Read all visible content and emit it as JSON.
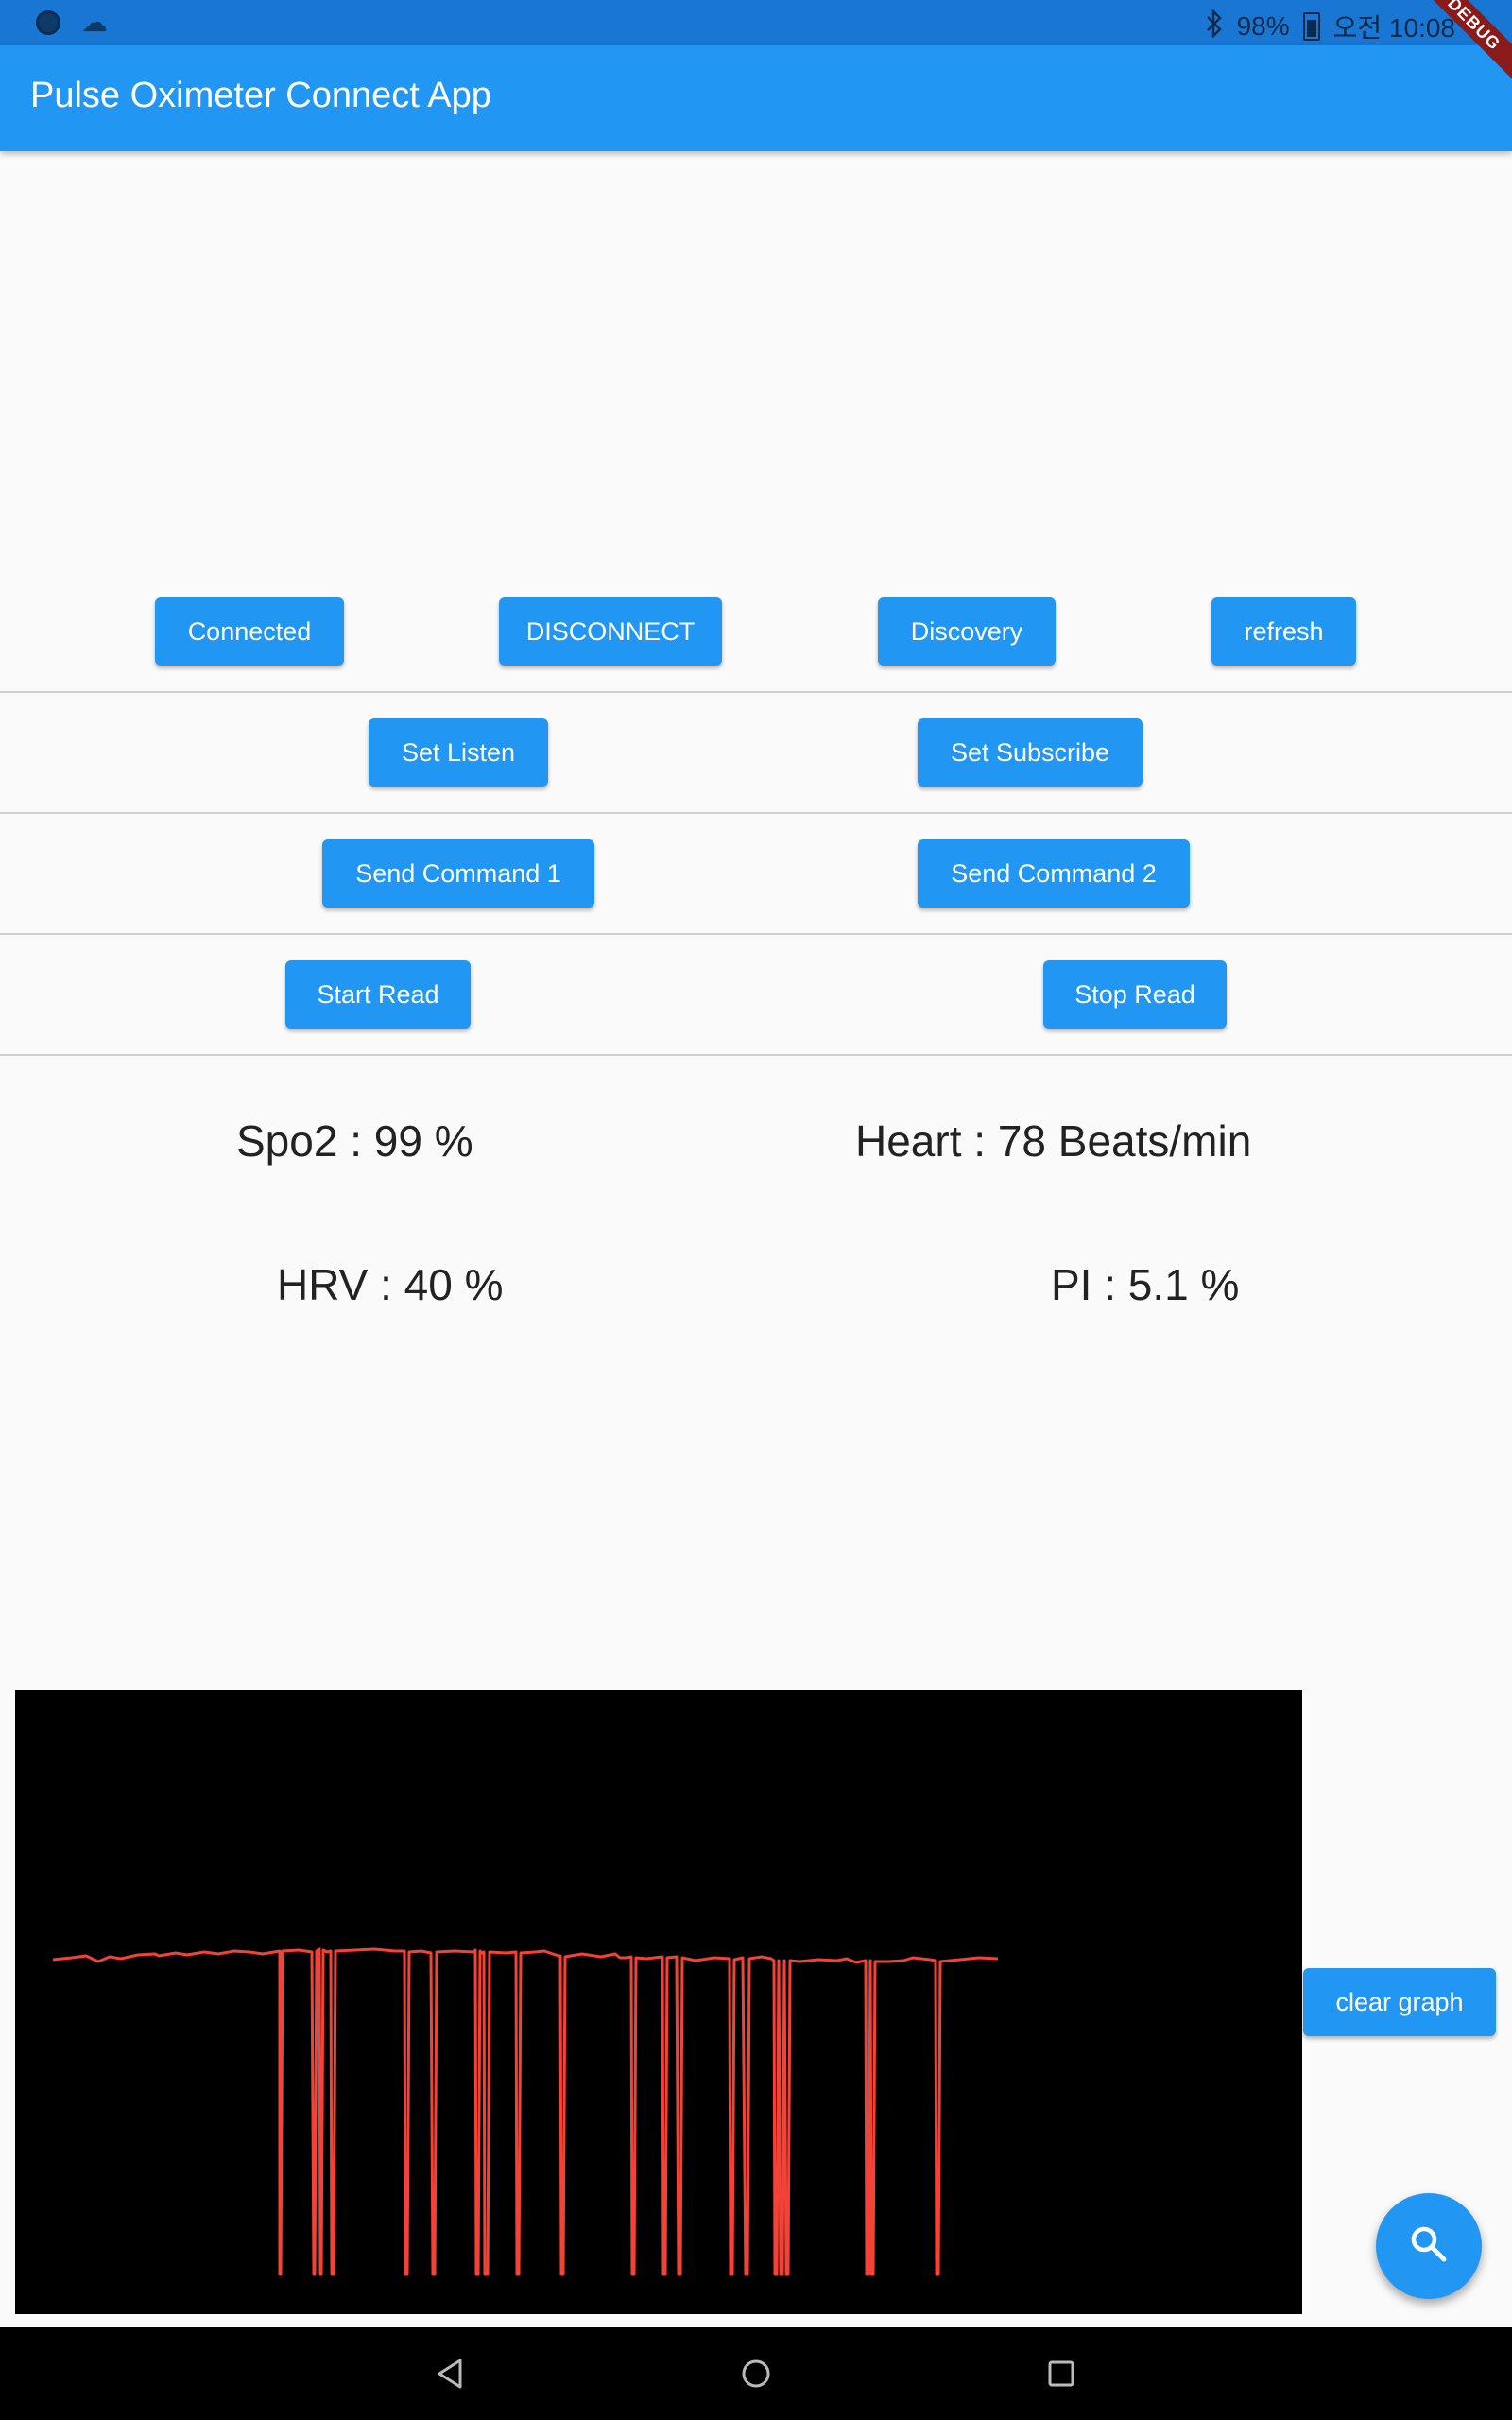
{
  "status_bar": {
    "battery": "98%",
    "time": "오전 10:08"
  },
  "debug_banner": "DEBUG",
  "app_bar": {
    "title": "Pulse Oximeter Connect App"
  },
  "controls": {
    "connected_label": "Connected",
    "disconnect_label": "DISCONNECT",
    "discovery_label": "Discovery",
    "refresh_label": "refresh",
    "set_listen_label": "Set Listen",
    "set_subscribe_label": "Set Subscribe",
    "send_command_1_label": "Send Command 1",
    "send_command_2_label": "Send Command 2",
    "start_read_label": "Start Read",
    "stop_read_label": "Stop Read"
  },
  "readings": {
    "spo2": "Spo2 : 99 %",
    "heart": "Heart : 78 Beats/min",
    "hrv": "HRV : 40 %",
    "pi": "PI : 5.1 %"
  },
  "graph": {
    "line_color": "#f44336",
    "background": "#000000"
  },
  "clear_graph_label": "clear graph",
  "colors": {
    "primary": "#2196f3",
    "status_bar": "#1976d2"
  }
}
